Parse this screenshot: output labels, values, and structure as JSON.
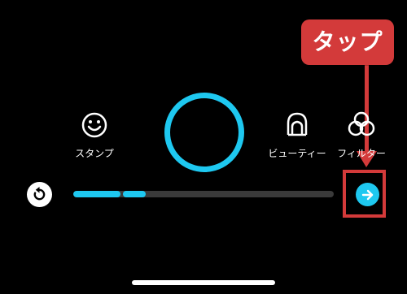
{
  "annotation": {
    "callout_label": "タップ",
    "color": "#d33a3a"
  },
  "tools": {
    "stamp": {
      "label": "スタンプ",
      "icon": "smiley-icon"
    },
    "beauty": {
      "label": "ビューティー",
      "icon": "face-outline-icon"
    },
    "filter": {
      "label": "フィルター",
      "icon": "filter-circles-icon"
    }
  },
  "shutter": {
    "icon": "record-ring",
    "color": "#1ec8f0"
  },
  "recording": {
    "progress": 0.28,
    "segments": 2,
    "track_color": "#3a3a3a",
    "fill_color": "#1ec8f0"
  },
  "controls": {
    "undo_icon": "undo-icon",
    "next_icon": "arrow-right-icon"
  }
}
